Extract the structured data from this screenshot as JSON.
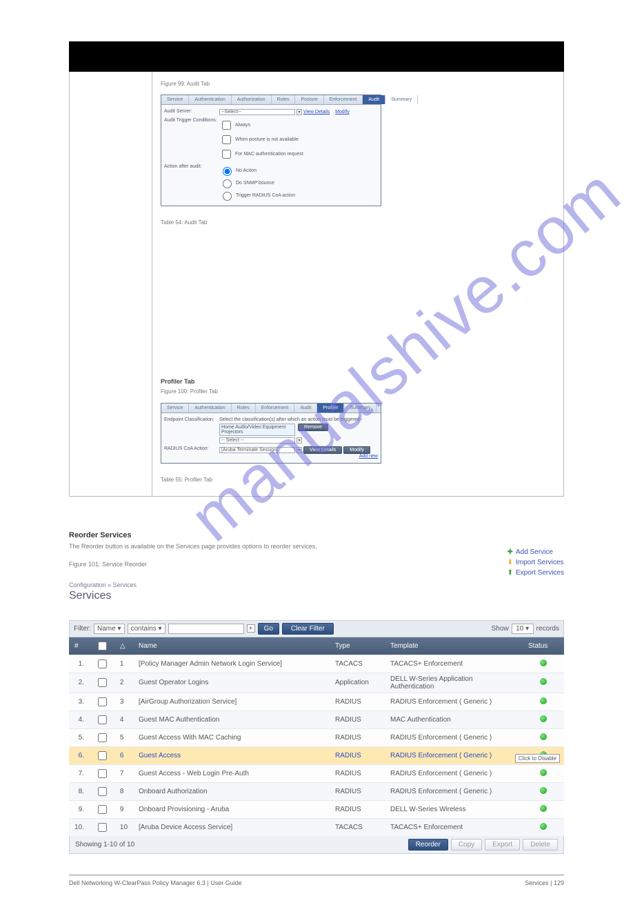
{
  "watermark": "manualshive.com",
  "top_frame": {
    "audit": {
      "tabs": [
        "Service",
        "Authentication",
        "Authorization",
        "Roles",
        "Posture",
        "Enforcement",
        "Audit",
        "Summary"
      ],
      "active_tab": "Audit",
      "fields": {
        "audit_server_label": "Audit Server:",
        "audit_server_value": "--Select--",
        "view_details": "View Details",
        "modify": "Modify",
        "trigger_label": "Audit Trigger Conditions:",
        "trigger_opts": [
          "Always",
          "When posture is not available",
          "For MAC authentication request"
        ],
        "action_label": "Action after audit:",
        "action_opts": [
          "No Action",
          "Do SNMP bounce",
          "Trigger RADIUS CoA action"
        ]
      },
      "intro": "Figure 99: Audit Tab",
      "post_note": "Table 54: Audit Tab"
    },
    "profiler": {
      "intro_head": "Profiler Tab",
      "intro_figcap": "Figure 100: Profiler Tab",
      "tabs": [
        "Service",
        "Authentication",
        "Roles",
        "Enforcement",
        "Audit",
        "Profiler",
        "Summary"
      ],
      "active_tab": "Profiler",
      "fields": {
        "endpoint_label": "Endpoint Classification:",
        "endpoint_hint": "Select the classification(s) after which an action must be triggered -",
        "endpoint_opts": [
          "Home Audio/Video Equipment",
          "Projectors"
        ],
        "endpoint_select": "-- Select --",
        "remove": "Remove",
        "coa_label": "RADIUS CoA Action:",
        "coa_value": "[Aruba Terminate Session]",
        "view_details": "View Details",
        "modify": "Modify",
        "add_new": "Add new"
      },
      "post_note": "Table 55: Profiler Tab"
    }
  },
  "middle_text": {
    "heading": "Reorder Services",
    "body": "The Reorder button is available on the Services page provides options to reorder services.",
    "figcap": "Figure 101: Service Reorder"
  },
  "services": {
    "breadcrumb": "Configuration » Services",
    "title": "Services",
    "action_links": {
      "add": "Add Service",
      "import": "Import Services",
      "export": "Export Services"
    },
    "filter": {
      "label": "Filter:",
      "field": "Name",
      "op": "contains",
      "go": "Go",
      "clear": "Clear Filter",
      "show_label_left": "Show",
      "show_value": "10",
      "show_label_right": "records"
    },
    "columns": [
      "#",
      "",
      "△",
      "Name",
      "Type",
      "Template",
      "Status"
    ],
    "rows": [
      {
        "n": "1.",
        "ord": "1",
        "name": "[Policy Manager Admin Network Login Service]",
        "type": "TACACS",
        "tmpl": "TACACS+ Enforcement"
      },
      {
        "n": "2.",
        "ord": "2",
        "name": "Guest Operator Logins",
        "type": "Application",
        "tmpl": "DELL W-Series Application Authentication"
      },
      {
        "n": "3.",
        "ord": "3",
        "name": "[AirGroup Authorization Service]",
        "type": "RADIUS",
        "tmpl": "RADIUS Enforcement ( Generic )"
      },
      {
        "n": "4.",
        "ord": "4",
        "name": "Guest MAC Authentication",
        "type": "RADIUS",
        "tmpl": "MAC Authentication"
      },
      {
        "n": "5.",
        "ord": "5",
        "name": "Guest Access With MAC Caching",
        "type": "RADIUS",
        "tmpl": "RADIUS Enforcement ( Generic )"
      },
      {
        "n": "6.",
        "ord": "6",
        "name": "Guest Access",
        "type": "RADIUS",
        "tmpl": "RADIUS Enforcement ( Generic )",
        "hl": true
      },
      {
        "n": "7.",
        "ord": "7",
        "name": "Guest Access - Web Login Pre-Auth",
        "type": "RADIUS",
        "tmpl": "RADIUS Enforcement ( Generic )"
      },
      {
        "n": "8.",
        "ord": "8",
        "name": "Onboard Authorization",
        "type": "RADIUS",
        "tmpl": "RADIUS Enforcement ( Generic )"
      },
      {
        "n": "9.",
        "ord": "9",
        "name": "Onboard Provisioning - Aruba",
        "type": "RADIUS",
        "tmpl": "DELL W-Series Wireless"
      },
      {
        "n": "10.",
        "ord": "10",
        "name": "[Aruba Device Access Service]",
        "type": "TACACS",
        "tmpl": "TACACS+ Enforcement"
      }
    ],
    "tooltip": "Click to Disable",
    "footer": {
      "showing": "Showing 1-10 of 10",
      "reorder": "Reorder",
      "copy": "Copy",
      "export": "Export",
      "delete": "Delete"
    }
  },
  "doc_footer": {
    "left": "Dell Networking W-ClearPass Policy Manager 6.3 | User Guide",
    "right": "Services | 129"
  }
}
